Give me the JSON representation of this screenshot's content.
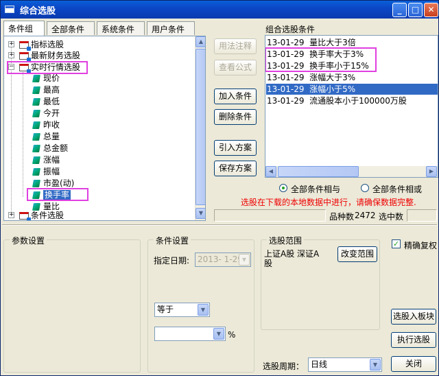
{
  "window": {
    "title": "综合选股"
  },
  "tabs": [
    {
      "label": "条件组",
      "active": true
    },
    {
      "label": "全部条件"
    },
    {
      "label": "系统条件"
    },
    {
      "label": "用户条件"
    }
  ],
  "tree": {
    "top_items": [
      "指标选股",
      "最新财务选股",
      "实时行情选股"
    ],
    "children": [
      "现价",
      "最高",
      "最低",
      "今开",
      "昨收",
      "总量",
      "总金额",
      "涨幅",
      "振幅",
      "市盈(动)",
      "换手率",
      "量比"
    ],
    "selected_child": "换手率",
    "bottom_item": "条件选股"
  },
  "buttons": {
    "annotation": "用法注释",
    "view_formula": "查看公式",
    "add_condition": "加入条件",
    "delete_condition": "删除条件",
    "import_plan": "引入方案",
    "save_plan": "保存方案",
    "change_range": "改变范围",
    "to_block": "选股入板块",
    "run": "执行选股",
    "close": "关闭"
  },
  "combo_conditions": {
    "title": "组合选股条件",
    "rows": [
      {
        "date": "13-01-29",
        "text": "量比大于3倍"
      },
      {
        "date": "13-01-29",
        "text": "换手率大于3%"
      },
      {
        "date": "13-01-29",
        "text": "换手率小于15%"
      },
      {
        "date": "13-01-29",
        "text": "涨幅大于3%"
      },
      {
        "date": "13-01-29",
        "text": "涨幅小于5%",
        "selected": true
      },
      {
        "date": "13-01-29",
        "text": "流通股本小于100000万股"
      }
    ]
  },
  "logic": {
    "and_label": "全部条件相与",
    "or_label": "全部条件相或",
    "selected": "and"
  },
  "warning": "选股在下载的本地数据中进行，请确保数据完整.",
  "status": {
    "count_label": "品种数",
    "count_value": "2472",
    "selected_label": "选中数"
  },
  "params": {
    "title": "参数设置"
  },
  "condition_settings": {
    "title": "条件设置",
    "date_label": "指定日期:",
    "date_value": "2013- 1-29",
    "operator": "等于",
    "value": "",
    "unit": "%"
  },
  "range": {
    "title": "选股范围",
    "text": "上证A股 深证A股"
  },
  "adjust": {
    "label": "精确复权",
    "checked": true
  },
  "period": {
    "label": "选股周期：",
    "value": "日线"
  },
  "colors": {
    "selection": "#316ac5",
    "warning": "#e00000",
    "highlight": "#e040e0"
  }
}
